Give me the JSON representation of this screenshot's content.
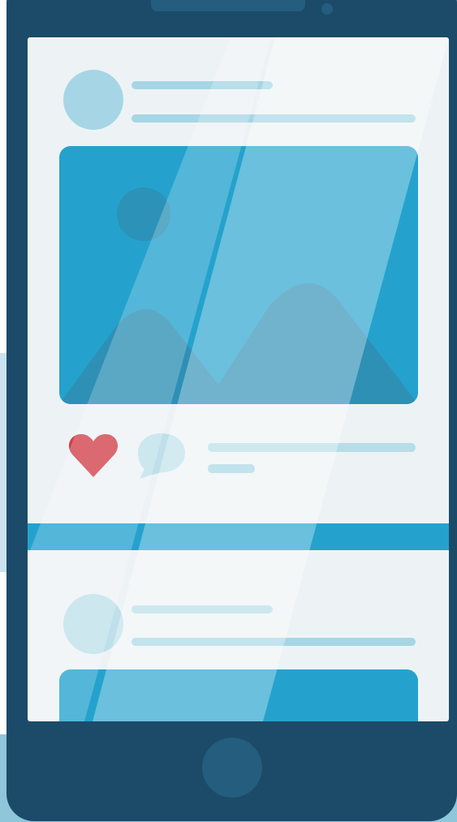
{
  "colors": {
    "phone_body": "#1b4b69",
    "phone_detail": "#245d7d",
    "screen": "#edf3f5",
    "accent_blue": "#24a2cd",
    "placeholder_line": "#a6d6e5",
    "avatar": "#a6d6e5",
    "heart": "#d13f4a",
    "comment_bubble": "#bfe0eb"
  },
  "icons": {
    "like": "heart-icon",
    "comment": "speech-bubble-icon",
    "image": "image-placeholder-icon"
  },
  "posts": [
    {
      "avatar": "avatar-placeholder",
      "has_image": true,
      "has_actions": true
    },
    {
      "avatar": "avatar-placeholder",
      "has_image": true,
      "has_actions": false
    }
  ]
}
